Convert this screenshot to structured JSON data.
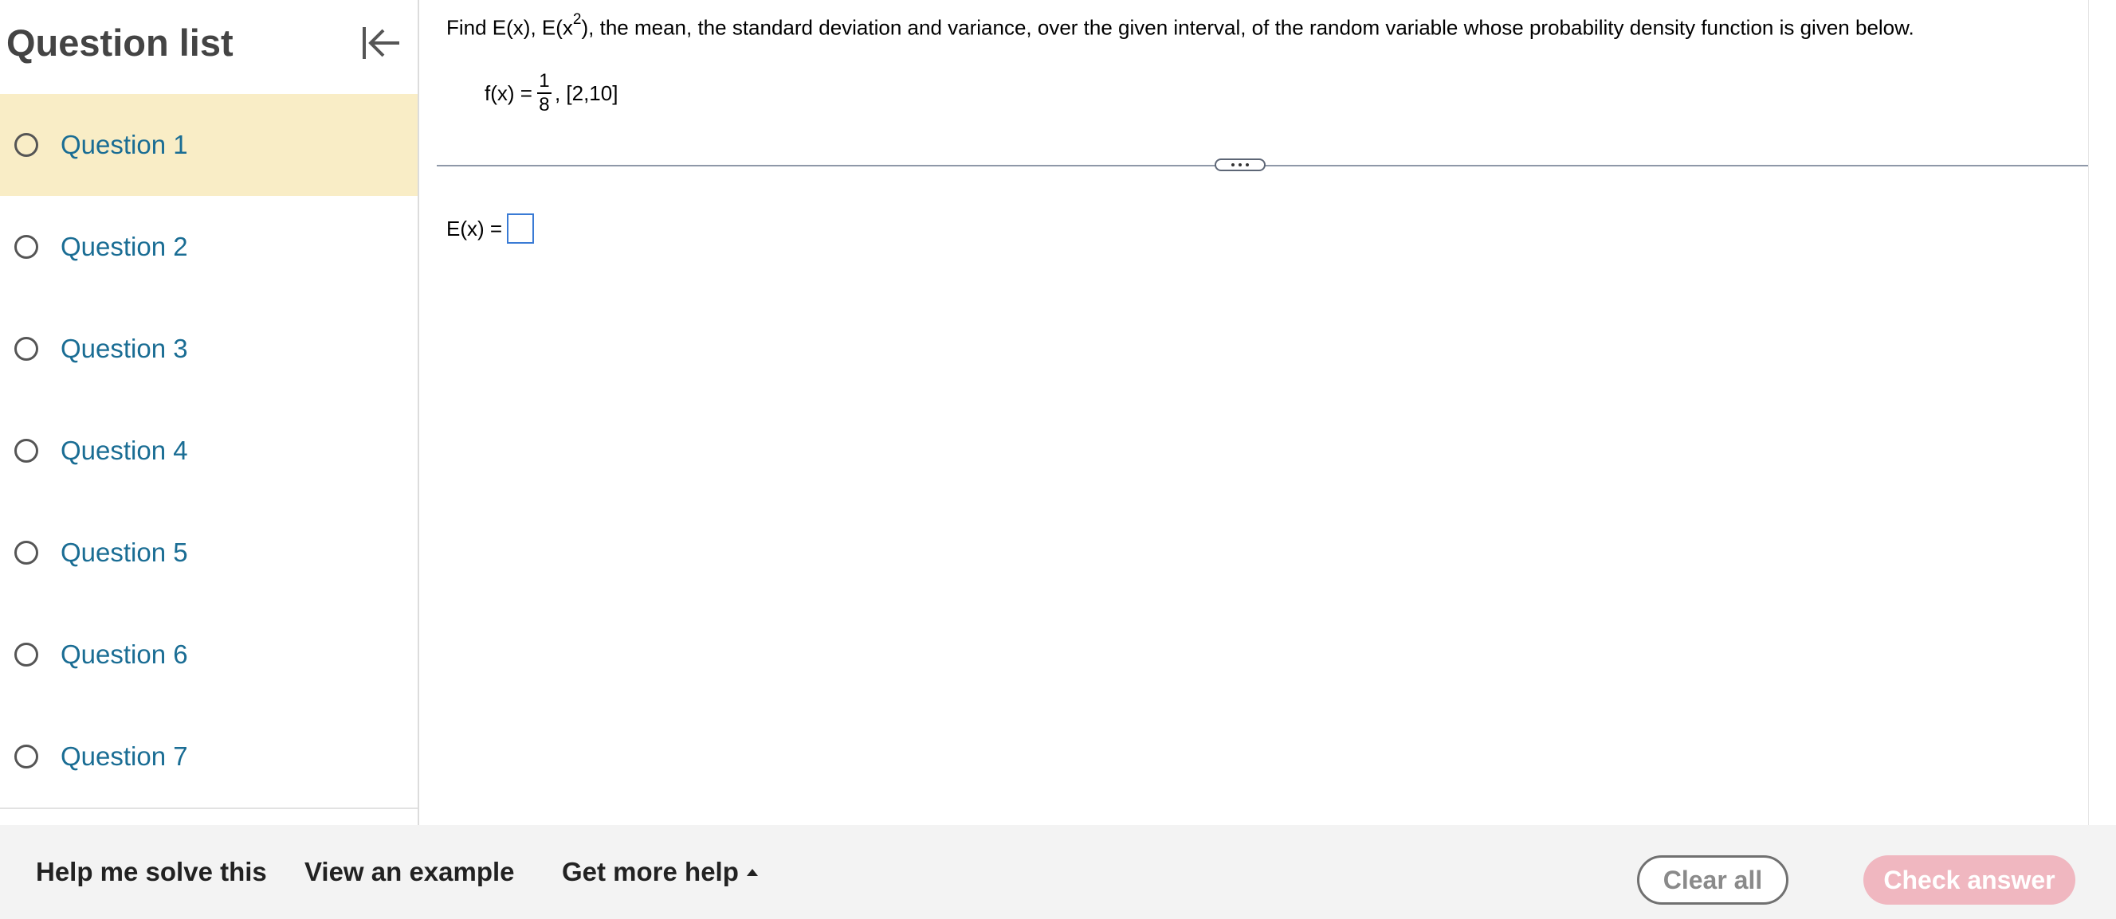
{
  "sidebar": {
    "title": "Question list",
    "questions": [
      {
        "label": "Question 1",
        "active": true
      },
      {
        "label": "Question 2",
        "active": false
      },
      {
        "label": "Question 3",
        "active": false
      },
      {
        "label": "Question 4",
        "active": false
      },
      {
        "label": "Question 5",
        "active": false
      },
      {
        "label": "Question 6",
        "active": false
      },
      {
        "label": "Question 7",
        "active": false
      }
    ]
  },
  "question": {
    "prefix": "Find E(x), E(x",
    "superscript": "2",
    "suffix": "), the mean, the standard deviation and variance, over the given interval, of the random variable whose probability density function is given below.",
    "formula_lhs": "f(x) =",
    "fraction_numerator": "1",
    "fraction_denominator": "8",
    "formula_rhs": ", [2,10]",
    "answer_label": "E(x) ="
  },
  "footer": {
    "help_me_solve": "Help me solve this",
    "view_example": "View an example",
    "get_more_help": "Get more help",
    "clear_all": "Clear all",
    "check_answer": "Check answer"
  },
  "colors": {
    "active_item_bg": "#f9edc6",
    "link_blue": "#1a6d94",
    "check_answer_bg": "#f0b7c0",
    "answer_box_border": "#3a7bd5"
  },
  "icons": {
    "collapse": "collapse-left-icon",
    "radio": "radio-empty-icon",
    "expand": "ellipsis-icon",
    "caret": "caret-up-icon"
  }
}
